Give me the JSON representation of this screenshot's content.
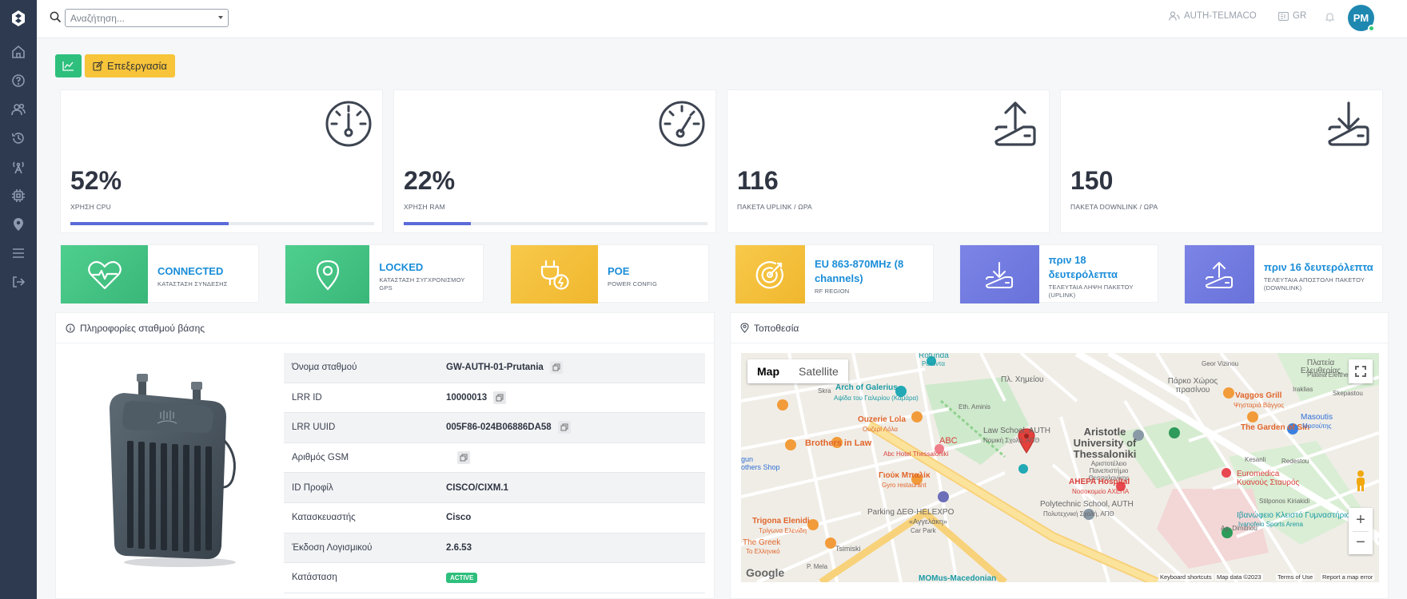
{
  "search": {
    "placeholder": "Αναζήτηση..."
  },
  "topbar": {
    "org": "AUTH-TELMACO",
    "language": "GR",
    "avatar_initials": "PM"
  },
  "toolbar": {
    "edit_label": "Επεξεργασία"
  },
  "stats": [
    {
      "value": "52%",
      "label": "ΧΡΗΣΗ CPU",
      "progress": 0.52
    },
    {
      "value": "22%",
      "label": "ΧΡΗΣΗ RAM",
      "progress": 0.22
    },
    {
      "value": "116",
      "label": "ΠΑΚΕΤΑ UPLINK / ΩΡΑ"
    },
    {
      "value": "150",
      "label": "ΠΑΚΕΤΑ DOWNLINK / ΩΡΑ"
    }
  ],
  "statuses": [
    {
      "title": "CONNECTED",
      "sub": "ΚΑΤΑΣΤΑΣΗ ΣΥΝΔΕΣΗΣ",
      "icon": "heart-pulse-icon",
      "color": "#3cc07e"
    },
    {
      "title": "LOCKED",
      "sub": "ΚΑΤΑΣΤΑΣΗ ΣΥΓΧΡΟΝΙΣΜΟΥ GPS",
      "icon": "map-pin-icon",
      "color": "#3cc07e"
    },
    {
      "title": "POE",
      "sub": "POWER CONFIG",
      "icon": "plug-icon",
      "color": "#f4bf38"
    },
    {
      "title": "EU 863-870MHz (8 channels)",
      "sub": "RF REGION",
      "icon": "radar-icon",
      "color": "#f4bf38"
    },
    {
      "title": "πριν 18 δευτερόλεπτα",
      "sub": "ΤΕΛΕΥΤΑΙΑ ΛΗΨΗ ΠΑΚΕΤΟΥ (UPLINK)",
      "icon": "download-icon",
      "color": "#6f79df"
    },
    {
      "title": "πριν 16 δευτερόλεπτα",
      "sub": "ΤΕΛΕΥΤΑΙΑ ΑΠΟΣΤΟΛΗ ΠΑΚΕΤΟΥ (DOWNLINK)",
      "icon": "upload-icon",
      "color": "#6f79df"
    }
  ],
  "info_panel": {
    "title": "Πληροφορίες σταθμού βάσης",
    "rows": [
      {
        "key": "Όνομα σταθμού",
        "value": "GW-AUTH-01-Prutania",
        "copy": true
      },
      {
        "key": "LRR ID",
        "value": "10000013",
        "copy": true
      },
      {
        "key": "LRR UUID",
        "value": "005F86-024B06886DA58",
        "copy": true
      },
      {
        "key": "Αριθμός GSM",
        "value": "",
        "copy": true
      },
      {
        "key": "ID Προφίλ",
        "value": "CISCO/CIXM.1"
      },
      {
        "key": "Κατασκευαστής",
        "value": "Cisco"
      },
      {
        "key": "Έκδοση Λογισμικού",
        "value": "2.6.53"
      },
      {
        "key": "Κατάσταση",
        "value": "ACTIVE",
        "badge": true
      }
    ]
  },
  "map_panel": {
    "title": "Τοποθεσία",
    "tabs": [
      "Map",
      "Satellite"
    ],
    "labels": {
      "rotunda": "Rotunda",
      "rotunda_gr": "Ροτόντα",
      "arch": "Arch of Galerius",
      "arch_gr": "Αψίδα του Γαλερίου (Καμάρα)",
      "ouzerie": "Ouzerie Lola",
      "ouzerie_gr": "Ουζερί Λόλα",
      "law": "Law School, AUTH",
      "law_gr": "Νομική Σχολή, ΑΠΘ",
      "aristotle": "Aristotle University of Thessaloniki",
      "aristotle_gr": "Αριστοτέλειο Πανεπιστήμιο Θεσσαλονίκης",
      "brothers": "Brothers in Law",
      "abc": "ABC",
      "abc_hotel": "Abc Hotel Thessaloniki",
      "gyros": "Γιούκ Μπαλίκ",
      "gyros_en": "Gyro restaurant",
      "ahepa": "AHEPA Hospital",
      "ahepa_gr": "Νοσοκομείο ΑΧΕΠΑ",
      "poly": "Polytechnic School, AUTH",
      "poly_gr": "Πολυτεχνική Σχολή, ΑΠΘ",
      "parking": "Parking ΔΕΘ-HELEXPO",
      "parking_gr": "«Αγγελάκη»",
      "carpark": "Car Park",
      "trigona": "Trigona Elenidi",
      "trigona_gr": "Τρίγωνα Ελενίδη",
      "greek": "The Greek",
      "greek_gr": "Το Ελληνικό",
      "momus": "MOMus-Macedonian",
      "vaggos": "Vaggos Grill",
      "vaggos_gr": "Ψησταριά Βάγγος",
      "garden": "The Garden of Sin",
      "masoutis": "Masoutis",
      "masoutis_gr": "Μασούτης",
      "euromedica": "Euromedica",
      "euromedica_gr": "Κυανούς Σταυρός",
      "ivanofeio": "Ιβανώφειο Κλειστό Γυμναστήριο",
      "ivanofeio_en": "Ivanofeio Sports Arena",
      "park": "Πάρκο Χώρος πρασίνου",
      "platia": "Πλατεία Ελευθερίας",
      "platia_en": "Plateia Eleftherias",
      "chimiou": "Πλ. Χημείου",
      "gun": "gun",
      "gun2": "others Shop",
      "skra": "Skra",
      "tsimiski": "Tsimiski",
      "eth_amynis": "Eth. Aminis",
      "geo_vizi": "Geor Vizinou",
      "iraklias": "Iraklias",
      "skepastou": "Skepastou",
      "redestou": "Redestou",
      "kesanli": "Kesanli",
      "stilponos": "Stilponos Kiriakidi",
      "ag_dimitriou": "Ag. Dimitriou",
      "p_mela": "P. Mela",
      "google": "Google",
      "shortcuts": "Keyboard shortcuts",
      "mapdata": "Map data ©2023",
      "terms": "Terms of Use",
      "report": "Report a map error"
    }
  },
  "colors": {
    "sidebar": "#2d3a4f",
    "accent_blue": "#1a8dd8",
    "progress": "#5b6bd9",
    "active_green": "#2ebf7d"
  }
}
